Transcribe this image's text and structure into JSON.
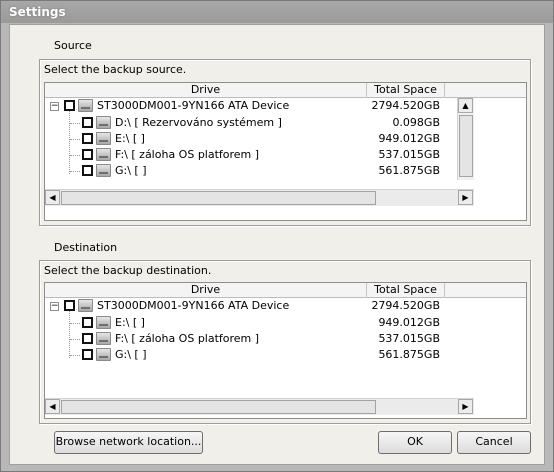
{
  "window": {
    "title": "Settings"
  },
  "source": {
    "section_label": "Source",
    "caption": "Select the backup source.",
    "columns": {
      "drive": "Drive",
      "space": "Total Space"
    },
    "device": {
      "name": "ST3000DM001-9YN166 ATA Device",
      "space": "2794.520GB"
    },
    "partitions": [
      {
        "label": "D:\\ [ Rezervováno systémem ]",
        "space": "0.098GB"
      },
      {
        "label": "E:\\ [ ]",
        "space": "949.012GB"
      },
      {
        "label": "F:\\ [ záloha OS platforem ]",
        "space": "537.015GB"
      },
      {
        "label": "G:\\ [ ]",
        "space": "561.875GB"
      }
    ]
  },
  "destination": {
    "section_label": "Destination",
    "caption": "Select the backup destination.",
    "columns": {
      "drive": "Drive",
      "space": "Total Space"
    },
    "device": {
      "name": "ST3000DM001-9YN166 ATA Device",
      "space": "2794.520GB"
    },
    "partitions": [
      {
        "label": "E:\\ [ ]",
        "space": "949.012GB"
      },
      {
        "label": "F:\\ [ záloha OS platforem ]",
        "space": "537.015GB"
      },
      {
        "label": "G:\\ [ ]",
        "space": "561.875GB"
      }
    ]
  },
  "buttons": {
    "browse": "Browse network location...",
    "ok": "OK",
    "cancel": "Cancel"
  },
  "icons": {
    "drive": "hard-drive-icon",
    "expander": "collapse-icon"
  }
}
